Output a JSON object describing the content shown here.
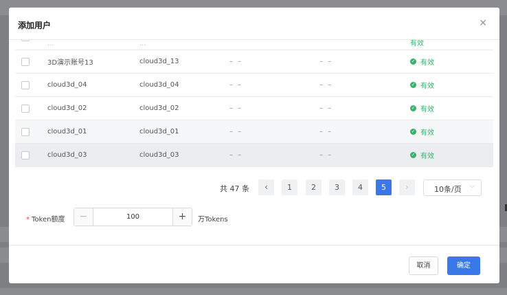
{
  "dialog": {
    "title": "添加用户",
    "close_icon": "close-icon"
  },
  "table": {
    "partial_row": {
      "name": "...",
      "account": "...",
      "d1": "– –",
      "d2": "– –",
      "status": "有效"
    },
    "rows": [
      {
        "name": "3D演示账号13",
        "account": "cloud3d_13",
        "d1": "– –",
        "d2": "– –",
        "status": "有效"
      },
      {
        "name": "cloud3d_04",
        "account": "cloud3d_04",
        "d1": "– –",
        "d2": "– –",
        "status": "有效"
      },
      {
        "name": "cloud3d_02",
        "account": "cloud3d_02",
        "d1": "– –",
        "d2": "– –",
        "status": "有效"
      },
      {
        "name": "cloud3d_01",
        "account": "cloud3d_01",
        "d1": "– –",
        "d2": "– –",
        "status": "有效"
      },
      {
        "name": "cloud3d_03",
        "account": "cloud3d_03",
        "d1": "– –",
        "d2": "– –",
        "status": "有效"
      }
    ],
    "status_color": "#35b36c"
  },
  "pagination": {
    "total_text": "共 47 条",
    "prev": "‹",
    "next": "›",
    "pages": [
      "1",
      "2",
      "3",
      "4",
      "5"
    ],
    "current_page": "5",
    "page_size": "10条/页"
  },
  "token": {
    "required_mark": "*",
    "label": "Token额度",
    "minus": "−",
    "plus": "+",
    "value": "100",
    "unit": "万Tokens"
  },
  "footer": {
    "cancel": "取消",
    "ok": "确定"
  },
  "accent_color": "#3b78e7"
}
